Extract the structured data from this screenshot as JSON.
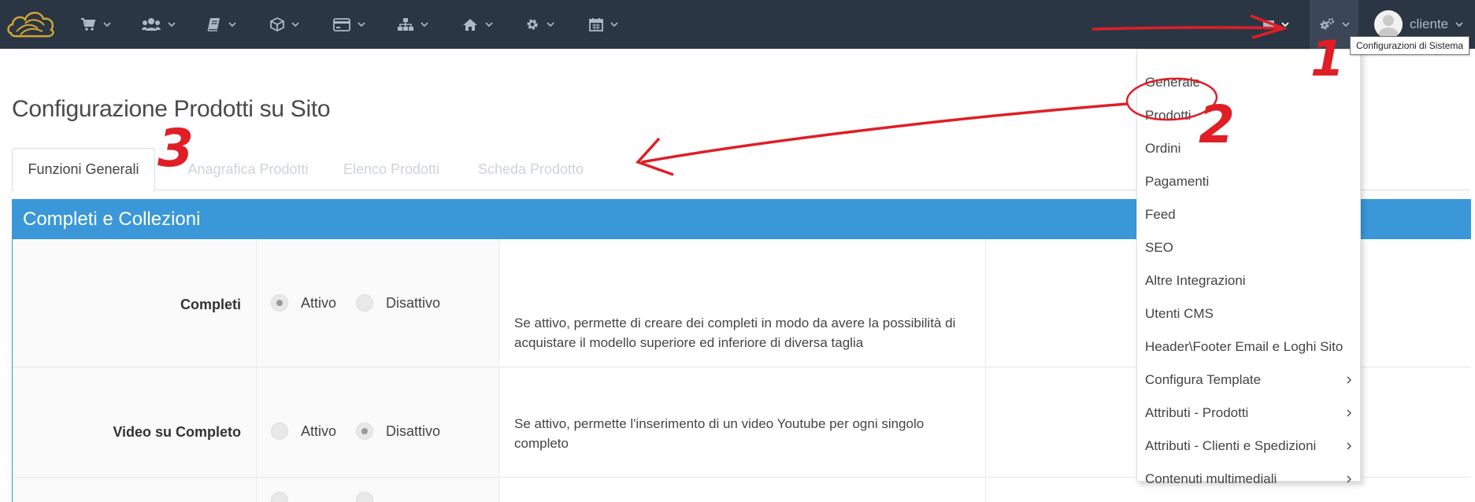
{
  "tooltip": "Configurazioni di Sistema",
  "user": {
    "name": "cliente"
  },
  "navbar": {
    "items": [
      {
        "icon": "shopping-cart-icon"
      },
      {
        "icon": "users-icon"
      },
      {
        "icon": "book-icon"
      },
      {
        "icon": "cube-icon"
      },
      {
        "icon": "credit-card-icon"
      },
      {
        "icon": "sitemap-icon"
      },
      {
        "icon": "home-icon"
      },
      {
        "icon": "gear-icon"
      },
      {
        "icon": "calendar-icon"
      },
      {
        "icon": "flag-icon"
      },
      {
        "icon": "gears-icon"
      }
    ]
  },
  "page": {
    "title": "Configurazione Prodotti su Sito"
  },
  "tabs": [
    {
      "label": "Funzioni Generali",
      "active": true
    },
    {
      "label": "Anagrafica Prodotti",
      "active": false
    },
    {
      "label": "Elenco Prodotti",
      "active": false
    },
    {
      "label": "Scheda Prodotto",
      "active": false
    }
  ],
  "panel": {
    "title": "Completi e Collezioni",
    "rows": [
      {
        "label": "Completi",
        "options": [
          {
            "label": "Attivo",
            "checked": true
          },
          {
            "label": "Disattivo",
            "checked": false
          }
        ],
        "description": "Se attivo, permette di creare dei completi in modo da avere la possibilità di acquistare il modello superiore ed inferiore di diversa taglia"
      },
      {
        "label": "Video su Completo",
        "options": [
          {
            "label": "Attivo",
            "checked": false
          },
          {
            "label": "Disattivo",
            "checked": true
          }
        ],
        "description": "Se attivo, permette l'inserimento di un video Youtube per ogni singolo completo"
      },
      {
        "label": "",
        "options": [
          {
            "label": "",
            "checked": false
          },
          {
            "label": "",
            "checked": false
          }
        ],
        "description": ""
      }
    ]
  },
  "dropdown": {
    "items": [
      {
        "label": "Generale",
        "submenu": false
      },
      {
        "label": "Prodotti",
        "submenu": false
      },
      {
        "label": "Ordini",
        "submenu": false
      },
      {
        "label": "Pagamenti",
        "submenu": false
      },
      {
        "label": "Feed",
        "submenu": false
      },
      {
        "label": "SEO",
        "submenu": false
      },
      {
        "label": "Altre Integrazioni",
        "submenu": false
      },
      {
        "label": "Utenti CMS",
        "submenu": false
      },
      {
        "label": "Header\\Footer Email e Loghi Sito",
        "submenu": false
      },
      {
        "label": "Configura Template",
        "submenu": true
      },
      {
        "label": "Attributi - Prodotti",
        "submenu": true
      },
      {
        "label": "Attributi - Clienti e Spedizioni",
        "submenu": true
      },
      {
        "label": "Contenuti multimediali",
        "submenu": true
      }
    ]
  },
  "annotations": {
    "steps": [
      "1",
      "2",
      "3"
    ],
    "color": "#e01e26"
  },
  "colors": {
    "navbar": "#2b3644",
    "accent": "#3a98d8",
    "logo": "#d4a833"
  }
}
